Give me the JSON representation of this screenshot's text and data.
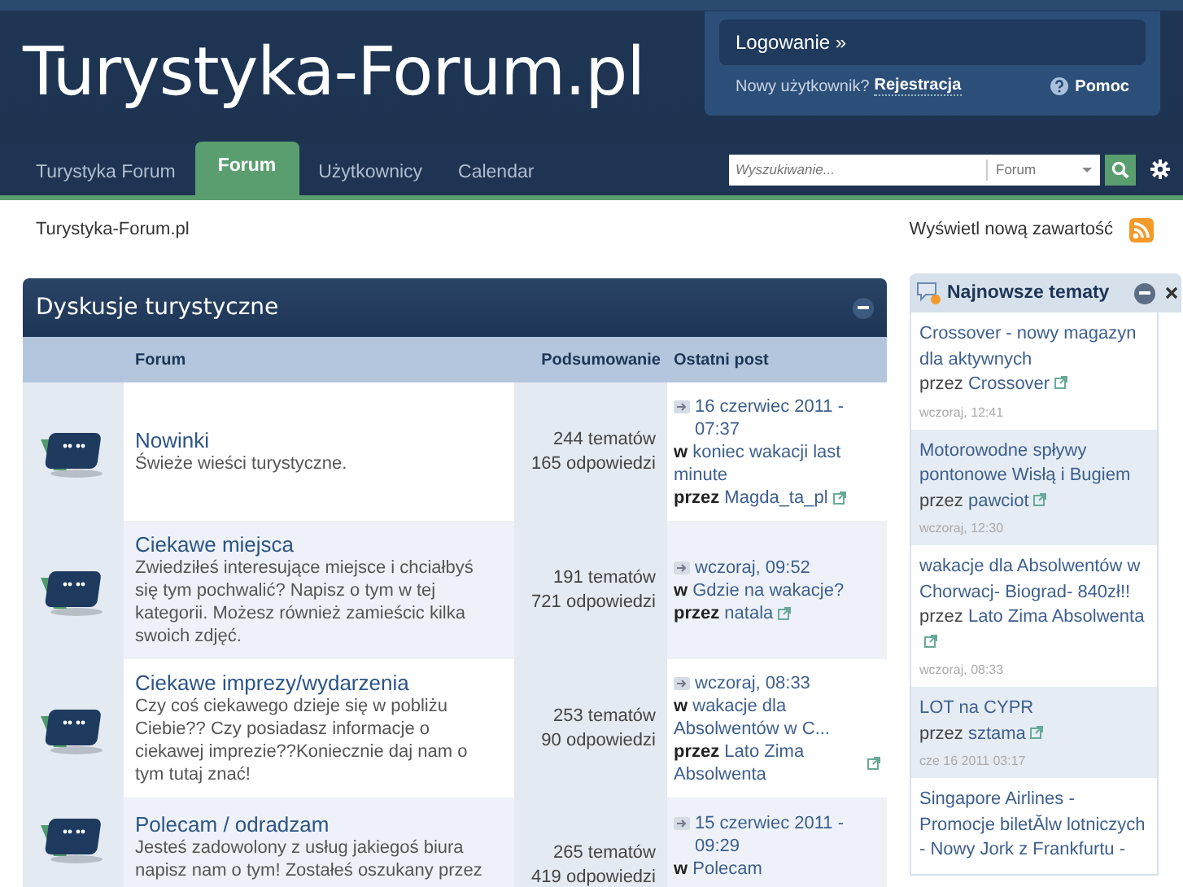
{
  "header": {
    "logo": "Turystyka-Forum.pl",
    "login": "Logowanie »",
    "new_user": "Nowy użytkownik?",
    "register": "Rejestracja",
    "help": "Pomoc"
  },
  "nav": {
    "tabs": [
      {
        "label": "Turystyka Forum",
        "selected": false
      },
      {
        "label": "Forum",
        "selected": true
      },
      {
        "label": "Użytkownicy",
        "selected": false
      },
      {
        "label": "Calendar",
        "selected": false
      }
    ],
    "search": {
      "placeholder": "Wyszukiwanie...",
      "scope": "Forum"
    }
  },
  "breadcrumb": "Turystyka-Forum.pl",
  "new_content": "Wyświetl nową zawartość",
  "category": {
    "title": "Dyskusje turystyczne",
    "columns": [
      "Forum",
      "Podsumowanie",
      "Ostatni post"
    ],
    "forums": [
      {
        "name": "Nowinki",
        "description": "Świeże wieści turystyczne.",
        "topics": "244 tematów",
        "replies": "165 odpowiedzi",
        "last_post": {
          "date": "16 czerwiec 2011 - 07:37",
          "in_label": "w",
          "topic": "koniec wakacji last minute",
          "by_label": "przez",
          "author": "Magda_ta_pl"
        }
      },
      {
        "name": "Ciekawe miejsca",
        "description": "Zwiedziłeś interesujące miejsce i chciałbyś się tym pochwalić? Napisz o tym w tej kategorii. Możesz również zamieścic kilka swoich zdjęć.",
        "topics": "191 tematów",
        "replies": "721 odpowiedzi",
        "last_post": {
          "date": "wczoraj, 09:52",
          "in_label": "w",
          "topic": "Gdzie na wakacje?",
          "by_label": "przez",
          "author": "natala"
        }
      },
      {
        "name": "Ciekawe imprezy/wydarzenia",
        "description": "Czy coś ciekawego dzieje się w pobliżu Ciebie?? Czy posiadasz informacje o ciekawej imprezie??Koniecznie daj nam o tym tutaj znać!",
        "topics": "253 tematów",
        "replies": "90 odpowiedzi",
        "last_post": {
          "date": "wczoraj, 08:33",
          "in_label": "w",
          "topic": "wakacje dla Absolwentów w C...",
          "by_label": "przez",
          "author": "Lato Zima Absolwenta"
        }
      },
      {
        "name": "Polecam / odradzam",
        "description": "Jesteś zadowolony z usług jakiegoś biura napisz nam o tym! Zostałeś oszukany przez",
        "topics": "265 tematów",
        "replies": "419 odpowiedzi",
        "last_post": {
          "date": "15 czerwiec 2011 - 09:29",
          "in_label": "w",
          "topic": "Polecam"
        }
      }
    ]
  },
  "sidebar": {
    "title": "Najnowsze tematy",
    "topics": [
      {
        "title": "Crossover - nowy magazyn dla aktywnych",
        "by_label": "przez",
        "author": "Crossover",
        "time": "wczoraj, 12:41"
      },
      {
        "title": "Motorowodne spływy pontonowe Wisłą i Bugiem",
        "by_label": "przez",
        "author": "pawciot",
        "time": "wczoraj, 12:30"
      },
      {
        "title": "wakacje dla Absolwentów w Chorwacj- Biograd- 840zł!!",
        "by_label": "przez",
        "author": "Lato Zima Absolwenta",
        "time": "wczoraj, 08:33"
      },
      {
        "title": "LOT na CYPR",
        "by_label": "przez",
        "author": "sztama",
        "time": "cze 16 2011 03:17"
      },
      {
        "title": "Singapore Airlines - Promocje biletĂlw lotniczych - Nowy Jork z Frankfurtu -"
      }
    ]
  }
}
